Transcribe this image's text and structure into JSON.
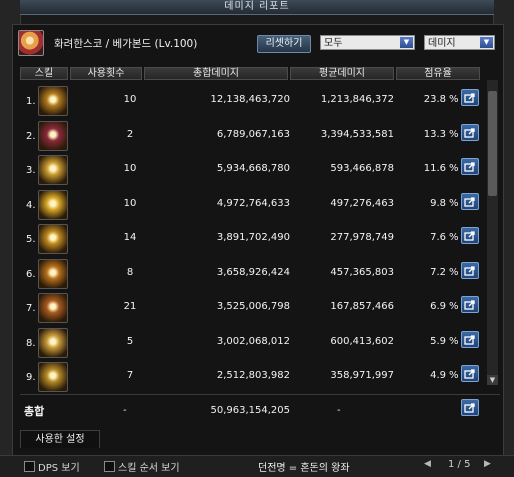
{
  "window": {
    "title": "데미지 리포트"
  },
  "character": {
    "name": "화려한스코 /",
    "class_info": "베가본드 (Lv.100)"
  },
  "controls": {
    "reset_label": "리셋하기",
    "filter_value": "모두",
    "type_value": "데미지"
  },
  "table": {
    "headers": {
      "skill": "스킬",
      "uses": "사용횟수",
      "total": "총합데미지",
      "avg": "평균데미지",
      "share": "점유율"
    },
    "rows": [
      {
        "rank": "1.",
        "uses": "10",
        "total": "12,138,463,720",
        "avg": "1,213,846,372",
        "pct": "23.8",
        "icon_color": "#b07a20"
      },
      {
        "rank": "2.",
        "uses": "2",
        "total": "6,789,067,163",
        "avg": "3,394,533,581",
        "pct": "13.3",
        "icon_color": "#8a2a3a"
      },
      {
        "rank": "3.",
        "uses": "10",
        "total": "5,934,668,780",
        "avg": "593,466,878",
        "pct": "11.6",
        "icon_color": "#c89a30"
      },
      {
        "rank": "4.",
        "uses": "10",
        "total": "4,972,764,633",
        "avg": "497,276,463",
        "pct": "9.8",
        "icon_color": "#d6a628"
      },
      {
        "rank": "5.",
        "uses": "14",
        "total": "3,891,702,490",
        "avg": "277,978,749",
        "pct": "7.6",
        "icon_color": "#c08a20"
      },
      {
        "rank": "6.",
        "uses": "8",
        "total": "3,658,926,424",
        "avg": "457,365,803",
        "pct": "7.2",
        "icon_color": "#b8701c"
      },
      {
        "rank": "7.",
        "uses": "21",
        "total": "3,525,006,798",
        "avg": "167,857,466",
        "pct": "6.9",
        "icon_color": "#a85a20"
      },
      {
        "rank": "8.",
        "uses": "5",
        "total": "3,002,068,012",
        "avg": "600,413,602",
        "pct": "5.9",
        "icon_color": "#c79a3a"
      },
      {
        "rank": "9.",
        "uses": "7",
        "total": "2,512,803,982",
        "avg": "358,971,997",
        "pct": "4.9",
        "icon_color": "#b48a28"
      }
    ],
    "pct_symbol": "%"
  },
  "totals": {
    "label": "총합",
    "uses": "-",
    "total": "50,963,154,205",
    "avg": "-"
  },
  "tabs": {
    "used_settings": "사용한 설정"
  },
  "footer": {
    "dps_label": "DPS 보기",
    "skill_order_label": "스킬 순서 보기",
    "title_line": "던전명 = 혼돈의 왕좌",
    "page": "1 / 5",
    "prev_icon": "◀",
    "next_icon": "▶"
  }
}
